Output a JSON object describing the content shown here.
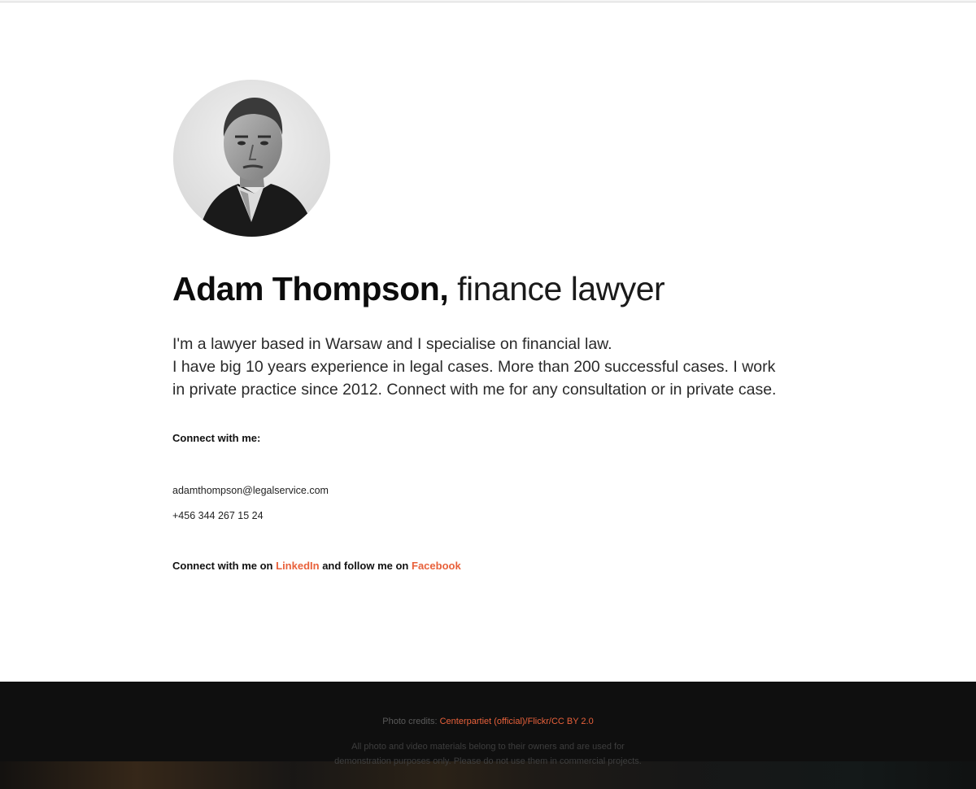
{
  "profile": {
    "name": "Adam Thompson,",
    "role": "finance lawyer",
    "bio_line1": "I'm a lawyer based in Warsaw and I specialise on financial law.",
    "bio_line2": "I have big 10 years experience in legal cases. More than 200 successful cases. I work in private practice since 2012. Connect with me for any consultation or in private case."
  },
  "contact": {
    "label": "Connect with me:",
    "email": "adamthompson@legalservice.com",
    "phone": "+456 344 267 15 24"
  },
  "social": {
    "prefix": "Connect with me on",
    "linkedin": "LinkedIn",
    "middle": "and follow me on",
    "facebook": "Facebook"
  },
  "footer": {
    "credits_label": "Photo credits:",
    "credits_link": "Centerpartiet (official)/Flickr/CC BY 2.0",
    "disclaimer_line1": "All photo and video materials belong to their owners and are used for",
    "disclaimer_line2": "demonstration purposes only. Please do not use them in commercial projects."
  },
  "colors": {
    "accent": "#e8613b",
    "footer_bg": "#0f0f0f"
  }
}
